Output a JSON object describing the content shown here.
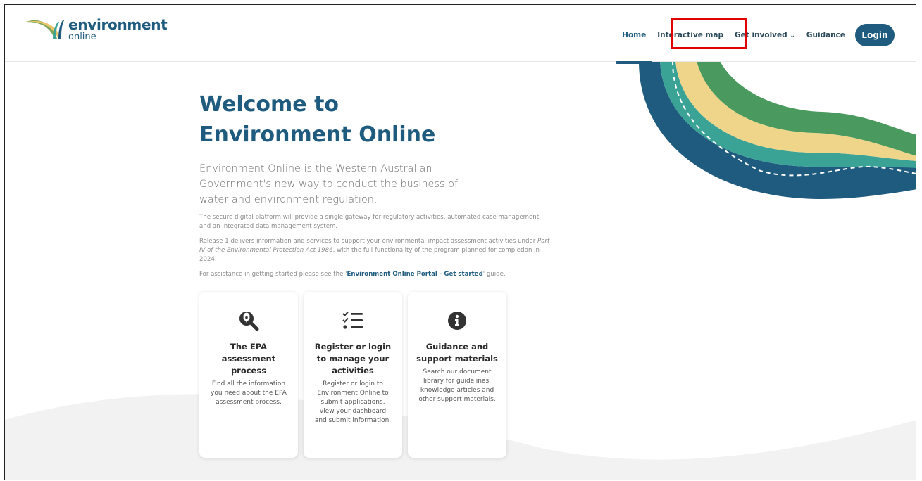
{
  "logo": {
    "main": "environment",
    "sub": "online"
  },
  "nav": {
    "home": "Home",
    "interactive_map": "Interactive map",
    "get_involved": "Get involved",
    "get_involved_chevron": "⌄",
    "guidance": "Guidance",
    "login": "Login"
  },
  "hero": {
    "title_line1": "Welcome to",
    "title_line2": "Environment Online",
    "lead": "Environment Online is the Western Australian Government's new way to conduct the business of water and environment regulation.",
    "para1": "The secure digital platform will provide a single gateway for regulatory activities, automated case management, and an integrated data management system.",
    "para2_before": "Release 1 delivers information and services to support your environmental impact assessment activities under ",
    "para2_italic": "Part IV of the Environmental Protection Act 1986",
    "para2_after": ", with the full functionality of the program planned for completion in 2024.",
    "para3_before": "For assistance in getting started please see the '",
    "para3_link": "Environment Online Portal - Get started",
    "para3_after": "' guide."
  },
  "cards": [
    {
      "icon": "search-location-icon",
      "title": "The EPA assessment process",
      "desc": "Find all the information you need about the EPA assessment process."
    },
    {
      "icon": "checklist-icon",
      "title": "Register or login to manage your activities",
      "desc": "Register or login to Environment Online to submit applications, view your dashboard and submit information."
    },
    {
      "icon": "info-circle-icon",
      "title": "Guidance and support materials",
      "desc": "Search our document library for guidelines, knowledge articles and other support materials."
    }
  ],
  "colors": {
    "brand_blue": "#1f5b7e",
    "wave_green": "#4a9a5f",
    "wave_yellow": "#efd58a",
    "wave_teal": "#3aa396",
    "highlight_red": "#e00000"
  }
}
